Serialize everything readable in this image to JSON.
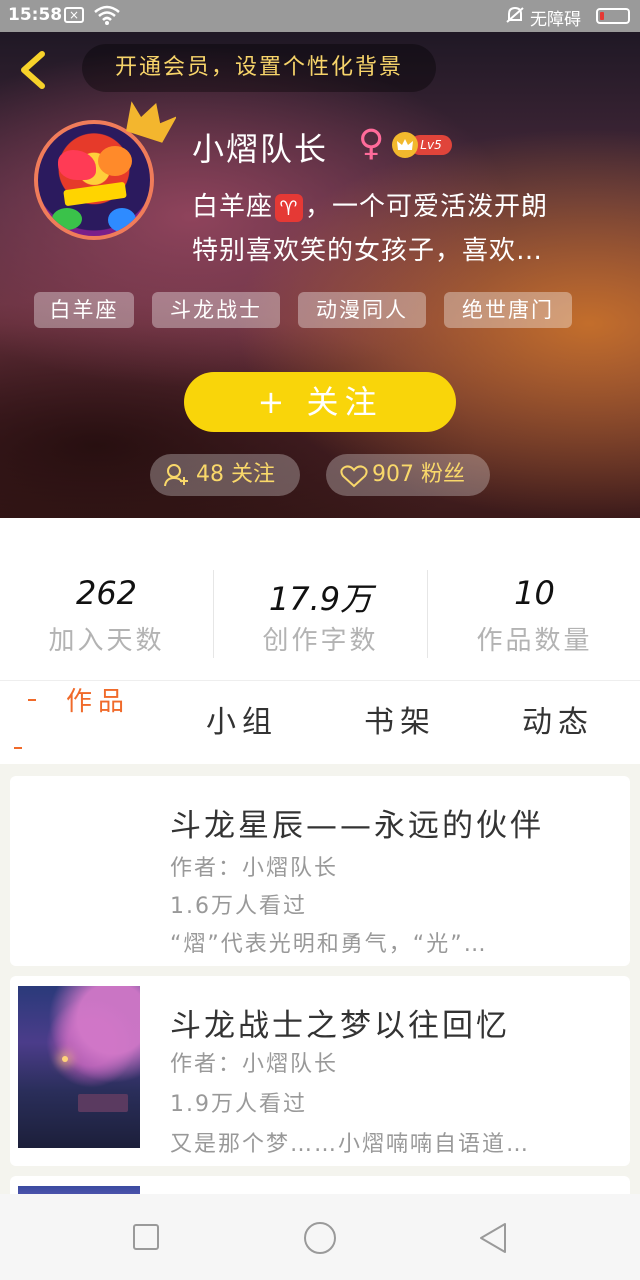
{
  "status_bar": {
    "time": "15:58",
    "notification_glyph": "×",
    "accessibility_label": "无障碍"
  },
  "header": {
    "vip_banner": "开通会员，设置个性化背景",
    "username": "小熠队长",
    "gender_symbol": "♀",
    "level": "Lv5",
    "bio_part1": "白羊座",
    "bio_emoji": "♈",
    "bio_part2": "，一个可爱活泼开朗",
    "bio_line2": "特别喜欢笑的女孩子，喜欢…",
    "tags": [
      "白羊座",
      "斗龙战士",
      "动漫同人",
      "绝世唐门"
    ],
    "follow_plus": "+",
    "follow_label": "关注",
    "following_text": "48 关注",
    "followers_text": "907 粉丝"
  },
  "stats": [
    {
      "value": "262",
      "label": "加入天数"
    },
    {
      "value": "17.9万",
      "label": "创作字数"
    },
    {
      "value": "10",
      "label": "作品数量"
    }
  ],
  "tabs": [
    "作品",
    "小组",
    "书架",
    "动态"
  ],
  "works": [
    {
      "title": "斗龙星辰——永远的伙伴",
      "author": "作者：小熠队长",
      "views": "1.6万人看过",
      "excerpt": "“熠”代表光明和勇气，“光”…"
    },
    {
      "title": "斗龙战士之梦以往回忆",
      "author": "作者：小熠队长",
      "views": "1.9万人看过",
      "excerpt": "又是那个梦……小熠喃喃自语道…"
    }
  ],
  "colors": {
    "accent_yellow": "#f9d50a",
    "tab_active": "#f06a2a",
    "gold_text": "#f7d46a"
  }
}
